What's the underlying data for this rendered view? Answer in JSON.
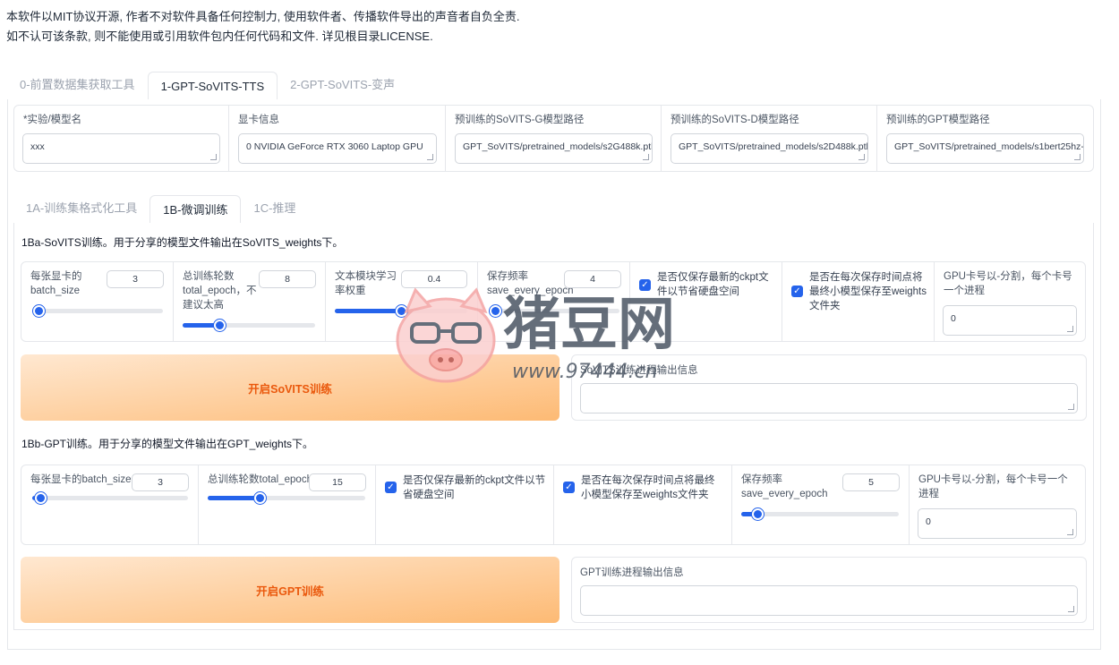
{
  "notice": {
    "line1": "本软件以MIT协议开源, 作者不对软件具备任何控制力, 使用软件者、传播软件导出的声音者自负全责.",
    "line2": "如不认可该条款, 则不能使用或引用软件包内任何代码和文件. 详见根目录LICENSE."
  },
  "main_tabs": [
    "0-前置数据集获取工具",
    "1-GPT-SoVITS-TTS",
    "2-GPT-SoVITS-变声"
  ],
  "top_fields": [
    {
      "label": "*实验/模型名",
      "value": "xxx"
    },
    {
      "label": "显卡信息",
      "value": "0  NVIDIA GeForce RTX 3060 Laptop GPU"
    },
    {
      "label": "预训练的SoVITS-G模型路径",
      "value": "GPT_SoVITS/pretrained_models/s2G488k.pth"
    },
    {
      "label": "预训练的SoVITS-D模型路径",
      "value": "GPT_SoVITS/pretrained_models/s2D488k.pth"
    },
    {
      "label": "预训练的GPT模型路径",
      "value": "GPT_SoVITS/pretrained_models/s1bert25hz-2kh-longer-epoch=68e-step=50232.ckpt"
    }
  ],
  "sub_tabs": [
    "1A-训练集格式化工具",
    "1B-微调训练",
    "1C-推理"
  ],
  "sovits": {
    "title": "1Ba-SoVITS训练。用于分享的模型文件输出在SoVITS_weights下。",
    "batch_label": "每张显卡的batch_size",
    "batch_value": "3",
    "epoch_label": "总训练轮数total_epoch，不建议太高",
    "epoch_value": "8",
    "text_lr_label": "文本模块学习率权重",
    "text_lr_value": "0.4",
    "save_every_label": "保存频率save_every_epoch",
    "save_every_value": "4",
    "only_latest_label": "是否仅保存最新的ckpt文件以节省硬盘空间",
    "save_small_label": "是否在每次保存时间点将最终小模型保存至weights文件夹",
    "gpu_label": "GPU卡号以-分割，每个卡号一个进程",
    "gpu_value": "0",
    "button": "开启SoVITS训练",
    "output_label": "SoVITS训练进程输出信息",
    "levels": {
      "batch": 0.05,
      "epoch": 0.28,
      "text_lr": 0.5,
      "save_every": 0.05
    }
  },
  "gpt": {
    "title": "1Bb-GPT训练。用于分享的模型文件输出在GPT_weights下。",
    "batch_label": "每张显卡的batch_size",
    "batch_value": "3",
    "epoch_label": "总训练轮数total_epoch",
    "epoch_value": "15",
    "only_latest_label": "是否仅保存最新的ckpt文件以节省硬盘空间",
    "save_small_label": "是否在每次保存时间点将最终小模型保存至weights文件夹",
    "save_every_label": "保存频率save_every_epoch",
    "save_every_value": "5",
    "gpu_label": "GPU卡号以-分割，每个卡号一个进程",
    "gpu_value": "0",
    "button": "开启GPT训练",
    "output_label": "GPT训练进程输出信息",
    "levels": {
      "batch": 0.05,
      "epoch": 0.33,
      "save_every": 0.1
    }
  },
  "watermark": {
    "title": "猪豆网",
    "url": "www.97444.cn"
  },
  "colors": {
    "accent": "#2563eb",
    "button_text": "#ea580c",
    "button_gradient_end": "#fdba74",
    "watermark": "#4b5563",
    "pig": "#f8b4b4"
  }
}
